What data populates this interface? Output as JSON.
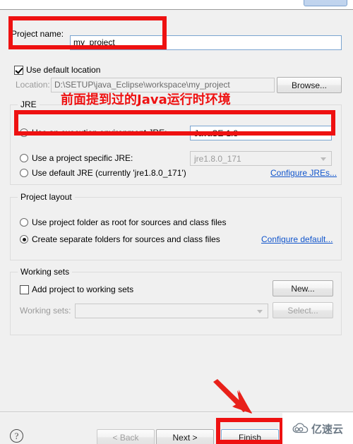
{
  "dialog": {
    "project_name_label": "Project name:",
    "project_name_value": "my_project",
    "use_default_location_label": "Use default location",
    "location_label": "Location:",
    "location_value": "D:\\SETUP\\java_Eclipse\\workspace\\my_project",
    "browse_button": "Browse..."
  },
  "jre": {
    "group_title": "JRE",
    "option_execution_env": "Use an execution environment JRE:",
    "execution_env_value": "JavaSE-1.8",
    "option_project_specific": "Use a project specific JRE:",
    "project_specific_value": "jre1.8.0_171",
    "option_default_jre": "Use default JRE (currently 'jre1.8.0_171')",
    "configure_link": "Configure JREs..."
  },
  "project_layout": {
    "group_title": "Project layout",
    "option_project_folder_root": "Use project folder as root for sources and class files",
    "option_separate_folders": "Create separate folders for sources and class files",
    "configure_link": "Configure default..."
  },
  "working_sets": {
    "group_title": "Working sets",
    "add_to_working_sets_label": "Add project to working sets",
    "new_button": "New...",
    "working_sets_label": "Working sets:",
    "working_sets_value": "",
    "select_button": "Select..."
  },
  "footer": {
    "help_icon": "?",
    "back_button": "< Back",
    "next_button": "Next >",
    "finish_button": "Finish"
  },
  "annotations": {
    "jre_note_text": "前面提到过的Java运行时环境",
    "highlight_color": "#ee1111",
    "arrow_color": "#e8211a"
  },
  "watermark": {
    "text": "亿速云",
    "icon": "cloud-icon"
  }
}
